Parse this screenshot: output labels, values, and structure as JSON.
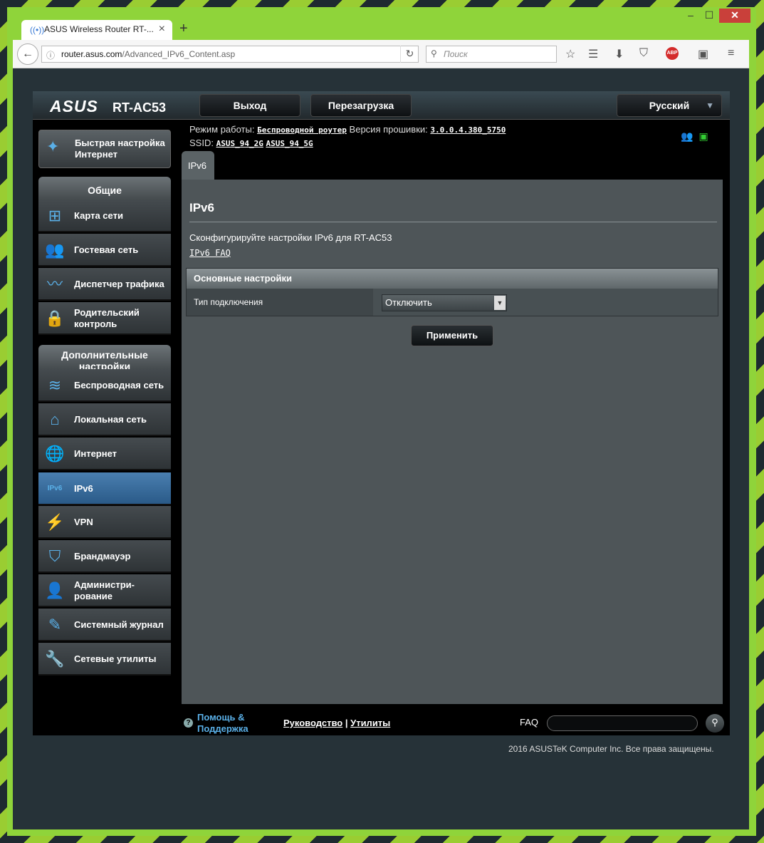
{
  "browser": {
    "tab_title": "ASUS Wireless Router RT-...",
    "url_host": "router.asus.com",
    "url_path": "/Advanced_IPv6_Content.asp",
    "search_placeholder": "Поиск",
    "abp_label": "ABP"
  },
  "router": {
    "logo": "ASUS",
    "model": "RT-AC53",
    "logout_label": "Выход",
    "reboot_label": "Перезагрузка",
    "language": "Русский",
    "mode_label": "Режим работы:",
    "mode_value": "Беспроводной роутер",
    "fw_label": "Версия прошивки:",
    "fw_value": "3.0.0.4.380_5750",
    "ssid_label": "SSID:",
    "ssid_1": "ASUS_94_2G",
    "ssid_2": "ASUS_94_5G"
  },
  "sidebar": {
    "quick_setup": "Быстрая настройка Интернет",
    "general_title": "Общие",
    "general_items": [
      {
        "label": "Карта сети"
      },
      {
        "label": "Гостевая сеть"
      },
      {
        "label": "Диспетчер трафика"
      },
      {
        "label": "Родительский контроль"
      }
    ],
    "advanced_title": "Дополнительные настройки",
    "advanced_items": [
      {
        "label": "Беспроводная сеть"
      },
      {
        "label": "Локальная сеть"
      },
      {
        "label": "Интернет"
      },
      {
        "label": "IPv6"
      },
      {
        "label": "VPN"
      },
      {
        "label": "Брандмауэр"
      },
      {
        "label": "Администри-рование"
      },
      {
        "label": "Системный журнал"
      },
      {
        "label": "Сетевые утилиты"
      }
    ]
  },
  "content": {
    "tab": "IPv6",
    "title": "IPv6",
    "description": "Сконфигурируйте настройки IPv6 для RT-AC53",
    "faq_link": "IPv6 FAQ",
    "section_title": "Основные настройки",
    "connection_type_label": "Тип подключения",
    "connection_type_value": "Отключить",
    "apply_label": "Применить"
  },
  "footer": {
    "help": "Помощь & Поддержка",
    "manual": "Руководство",
    "separator": "|",
    "utilities": "Утилиты",
    "faq_label": "FAQ",
    "copyright": "2016 ASUSTeK Computer Inc. Все права защищены."
  }
}
